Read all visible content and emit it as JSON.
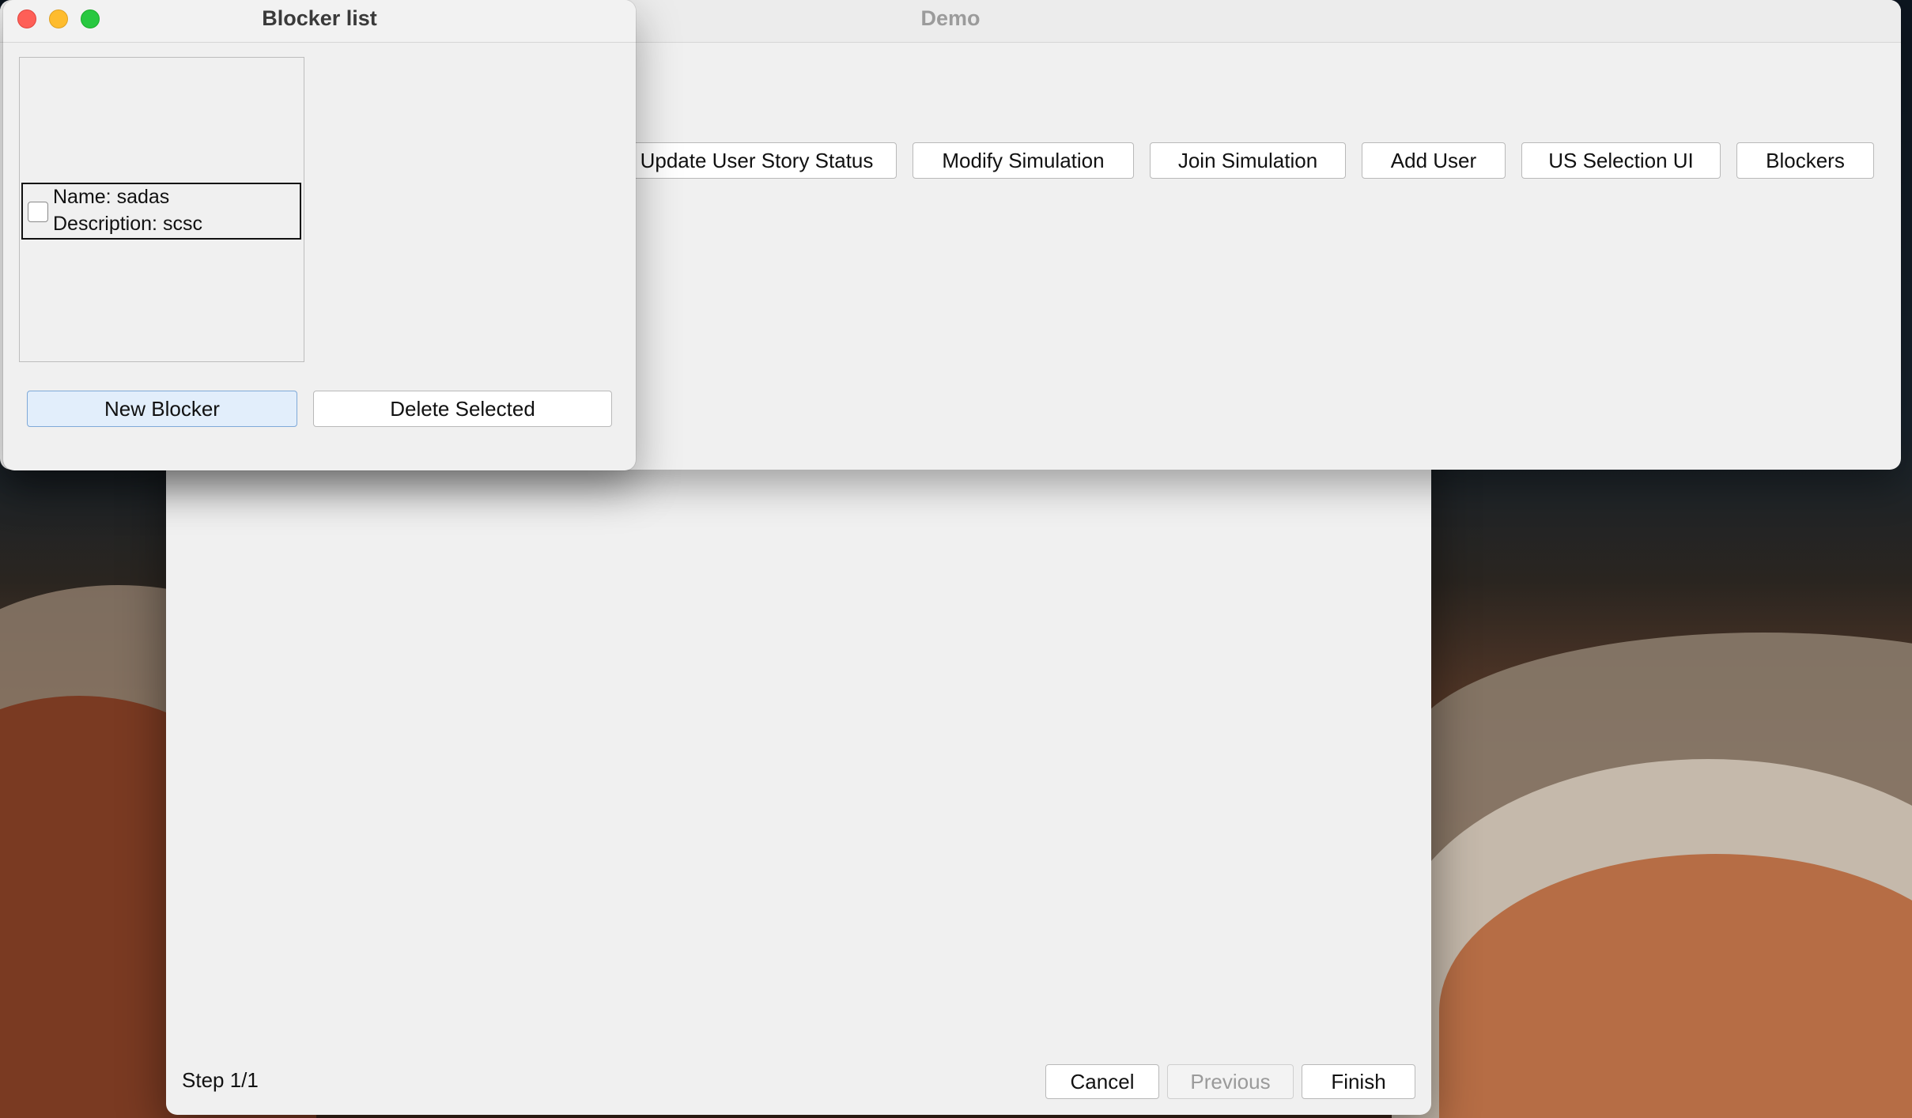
{
  "blocker_window": {
    "title": "Blocker list",
    "items": [
      {
        "name_line": "Name: sadas",
        "description_line": "Description: scsc",
        "checked": false
      }
    ],
    "new_button": "New Blocker",
    "delete_button": "Delete Selected"
  },
  "demo_window": {
    "title": "Demo",
    "buttons": [
      "Update User Story Status",
      "Modify Simulation",
      "Join Simulation",
      "Add User",
      "US Selection UI",
      "Blockers"
    ]
  },
  "wizard_window": {
    "step_label": "Step 1/1",
    "cancel_button": "Cancel",
    "previous_button": "Previous",
    "finish_button": "Finish"
  },
  "colors": {
    "accent_button_bg": "#e2eefb",
    "accent_button_border": "#7fa9d8",
    "traffic_red": "#fe5f57",
    "traffic_yellow": "#febc2e",
    "traffic_green": "#28c840"
  }
}
